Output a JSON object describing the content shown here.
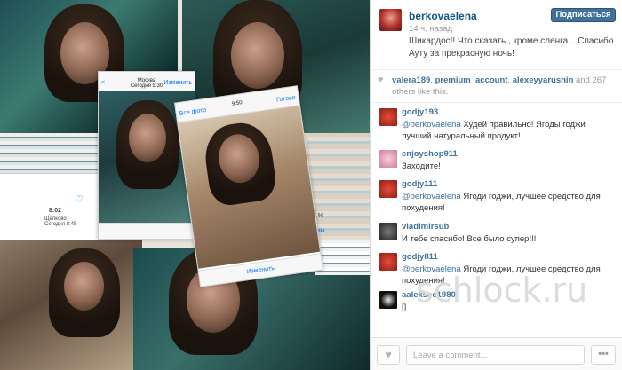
{
  "post": {
    "username": "berkovaelena",
    "time": "14 ч. назад",
    "follow_label": "Подписаться",
    "caption": "Шикардос!! Что сказать , кроме сленга... Спасибо Ауту за прекрасную ночь!"
  },
  "photo": {
    "phone1": {
      "back": "<",
      "title": "Москва\nСегодня 9:30",
      "action": "Изменить"
    },
    "phone2": {
      "back": "Все фото",
      "time": "9:50",
      "action": "Готово",
      "footer_action": "Изменить"
    },
    "left_tile": {
      "time": "8:02",
      "day": "Щелково\nСегодня 8:45"
    },
    "right_tile": {
      "battery": "65 %",
      "action": "Измени"
    }
  },
  "likes": {
    "users": [
      "valera189",
      "premium_account",
      "alexeyyarushin"
    ],
    "and": "and",
    "count": "267",
    "suffix": "others like this."
  },
  "comments": [
    {
      "user": "godjy193",
      "mention": "@berkovaelena",
      "text": " Худей правильно! Ягоды годжи лучший натуральный продукт!",
      "avatar_color": "#c0392b"
    },
    {
      "user": "enjoyshop911",
      "mention": "",
      "text": "Заходите!",
      "avatar_color": "#e7a0b4"
    },
    {
      "user": "godjy111",
      "mention": "@berkovaelena",
      "text": " Ягоди годжи, лучшее средство для похудения!",
      "avatar_color": "#c0392b"
    },
    {
      "user": "vladimirsub",
      "mention": "",
      "text": "И тебе спасибо! Все было супер!!!",
      "avatar_color": "#3b3b3b"
    },
    {
      "user": "godjy811",
      "mention": "@berkovaelena",
      "text": " Ягоди годжи, лучшее средство для похудения!",
      "avatar_color": "#c0392b"
    },
    {
      "user": "aaleksee1980",
      "mention": "",
      "text": "[]",
      "avatar_color": "#111111"
    }
  ],
  "footer": {
    "comment_placeholder": "Leave a comment...",
    "more_label": "•••"
  },
  "watermark": "schlock.ru",
  "colors": {
    "link": "#3f729b",
    "follow_bg": "#3f729b",
    "username": "#125688"
  },
  "icons": {
    "like": "heart-icon",
    "more": "ellipsis-icon"
  }
}
